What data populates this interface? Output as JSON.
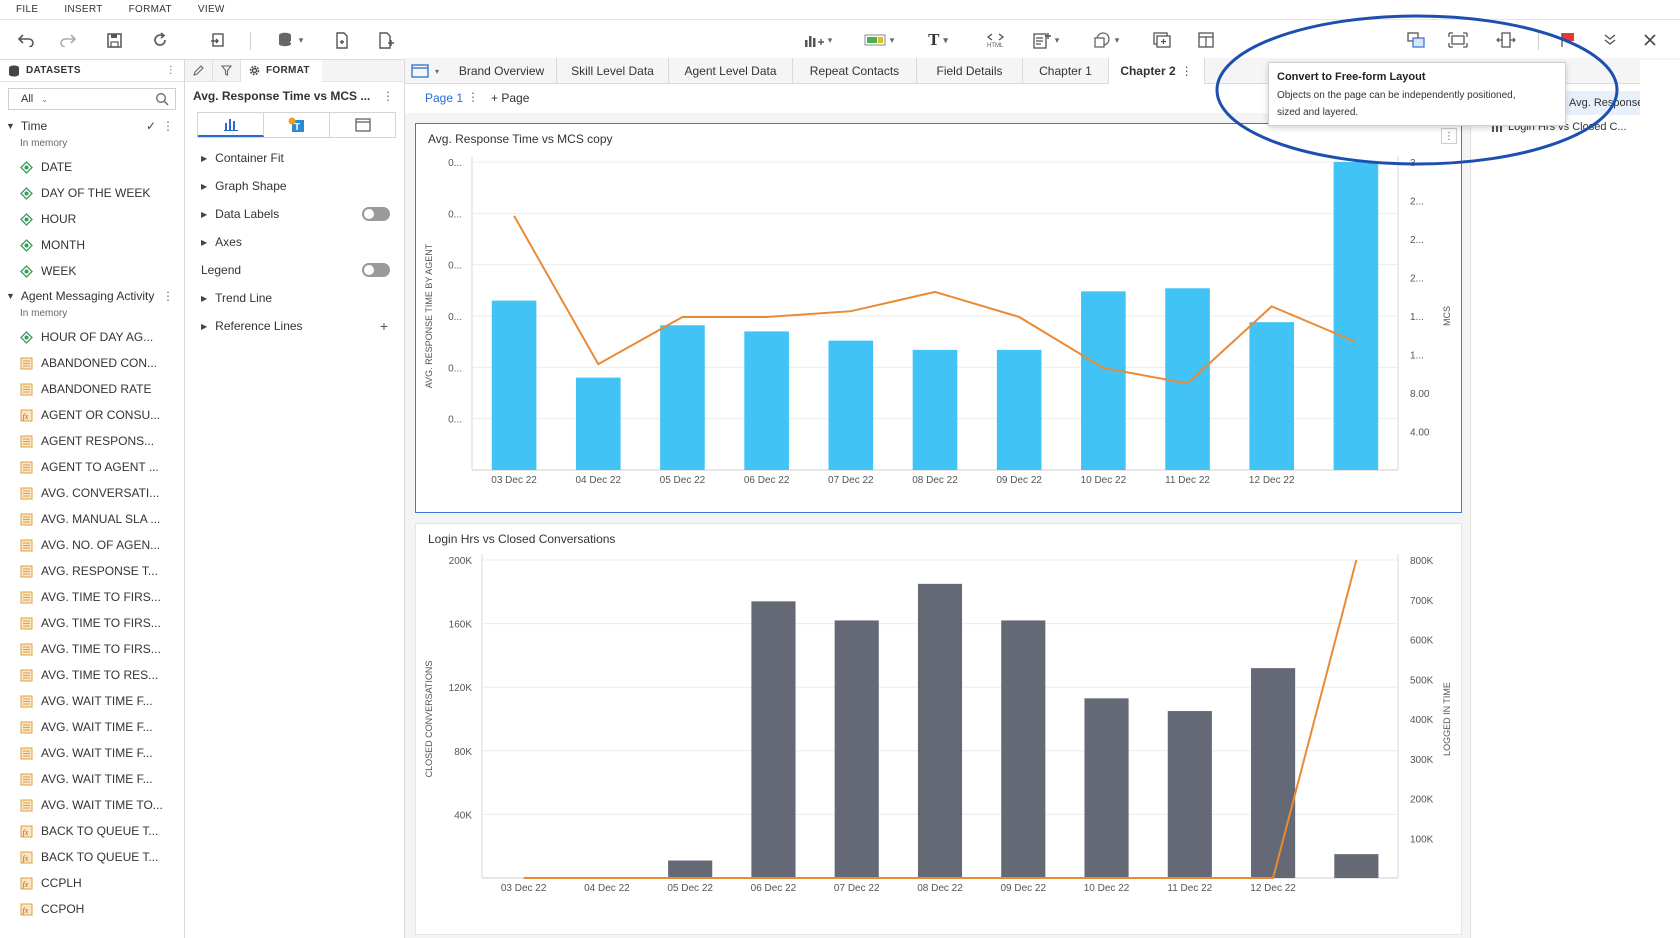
{
  "menu": [
    "FILE",
    "INSERT",
    "FORMAT",
    "VIEW"
  ],
  "datasets": {
    "header": "DATASETS",
    "filter_value": "All",
    "groups": [
      {
        "name": "Time",
        "status": "In memory",
        "fields": [
          "DATE",
          "DAY OF THE WEEK",
          "HOUR",
          "MONTH",
          "WEEK"
        ]
      },
      {
        "name": "Agent Messaging Activity",
        "status": "In memory",
        "fields": [
          "HOUR OF DAY AG...",
          "ABANDONED CON...",
          "ABANDONED RATE",
          "AGENT OR CONSU...",
          "AGENT RESPONS...",
          "AGENT TO AGENT ...",
          "AVG. CONVERSATI...",
          "AVG. MANUAL SLA ...",
          "AVG. NO. OF AGEN...",
          "AVG. RESPONSE T...",
          "AVG. TIME TO FIRS...",
          "AVG. TIME TO FIRS...",
          "AVG. TIME TO FIRS...",
          "AVG. TIME TO RES...",
          "AVG. WAIT TIME F...",
          "AVG. WAIT TIME F...",
          "AVG. WAIT TIME F...",
          "AVG. WAIT TIME F...",
          "AVG. WAIT TIME TO...",
          "BACK TO QUEUE T...",
          "BACK TO QUEUE T...",
          "CCPLH",
          "CCPOH"
        ]
      }
    ]
  },
  "format_panel": {
    "tab_label": "FORMAT",
    "viz_title": "Avg. Response Time vs MCS ...",
    "sections": [
      "Container Fit",
      "Graph Shape",
      "Data Labels",
      "Axes",
      "Legend",
      "Trend Line",
      "Reference Lines"
    ]
  },
  "chapter_tabs": [
    "Brand Overview",
    "Skill Level Data",
    "Agent Level Data",
    "Repeat Contacts",
    "Field Details",
    "Chapter 1",
    "Chapter 2"
  ],
  "active_tab": "Chapter 2",
  "page": {
    "label": "Page 1",
    "add_label": "Page"
  },
  "tooltip": {
    "title": "Convert to Free-form Layout",
    "body_line1": "Objects on the page can be independently positioned,",
    "body_line2": "sized and layered."
  },
  "right_panel": {
    "items": [
      "Avg. Response Time ...",
      "Login Hrs vs Closed C..."
    ]
  },
  "colors": {
    "accent": "#2a6bd1",
    "bar_blue": "#41c3f5",
    "bar_gray": "#646975",
    "line_orange": "#e98a35",
    "annotation_circle": "#1c4fb0"
  },
  "chart_data": [
    {
      "type": "bar",
      "title": "Avg. Response Time vs MCS copy",
      "categories": [
        "03 Dec 22",
        "04 Dec 22",
        "05 Dec 22",
        "06 Dec 22",
        "07 Dec 22",
        "08 Dec 22",
        "09 Dec 22",
        "10 Dec 22",
        "11 Dec 22",
        "12 Dec 22",
        ""
      ],
      "ylabel": "AVG. RESPONSE TIME BY AGENT",
      "y2label": "MCS",
      "y_ticks": [
        "0...",
        "0...",
        "0...",
        "0...",
        "0...",
        "0..."
      ],
      "y2_ticks": [
        "3",
        "2...",
        "2...",
        "2...",
        "1...",
        "1...",
        "8.00",
        "4.00"
      ],
      "series": [
        {
          "type": "bar",
          "values": [
            0.55,
            0.3,
            0.47,
            0.45,
            0.42,
            0.39,
            0.39,
            0.58,
            0.59,
            0.48,
            1.0
          ]
        },
        {
          "type": "line",
          "axis": "right",
          "values": [
            26.4,
            11.0,
            15.9,
            15.9,
            16.5,
            18.5,
            15.9,
            10.6,
            9.0,
            17.0,
            13.3
          ]
        }
      ],
      "ylim": [
        0,
        1.0
      ],
      "y2lim": [
        0,
        32
      ],
      "legend": "hidden",
      "grid": true
    },
    {
      "type": "bar",
      "title": "Login Hrs vs Closed Conversations",
      "categories": [
        "03 Dec 22",
        "04 Dec 22",
        "05 Dec 22",
        "06 Dec 22",
        "07 Dec 22",
        "08 Dec 22",
        "09 Dec 22",
        "10 Dec 22",
        "11 Dec 22",
        "12 Dec 22",
        ""
      ],
      "ylabel": "CLOSED CONVERSATIONS",
      "y2label": "LOGGED IN TIME",
      "y_ticks": [
        "40K",
        "80K",
        "120K",
        "160K",
        "200K"
      ],
      "y2_ticks": [
        "100K",
        "200K",
        "300K",
        "400K",
        "500K",
        "600K",
        "700K",
        "800K"
      ],
      "series": [
        {
          "type": "bar",
          "values": [
            0,
            0,
            11000,
            174000,
            162000,
            185000,
            162000,
            113000,
            105000,
            132000,
            15000
          ]
        },
        {
          "type": "line",
          "axis": "right",
          "values": [
            0,
            0,
            0,
            0,
            0,
            0,
            0,
            0,
            0,
            0,
            800000
          ]
        }
      ],
      "ylim": [
        0,
        200000
      ],
      "y2lim": [
        0,
        800000
      ],
      "legend": "hidden",
      "grid": true
    }
  ]
}
